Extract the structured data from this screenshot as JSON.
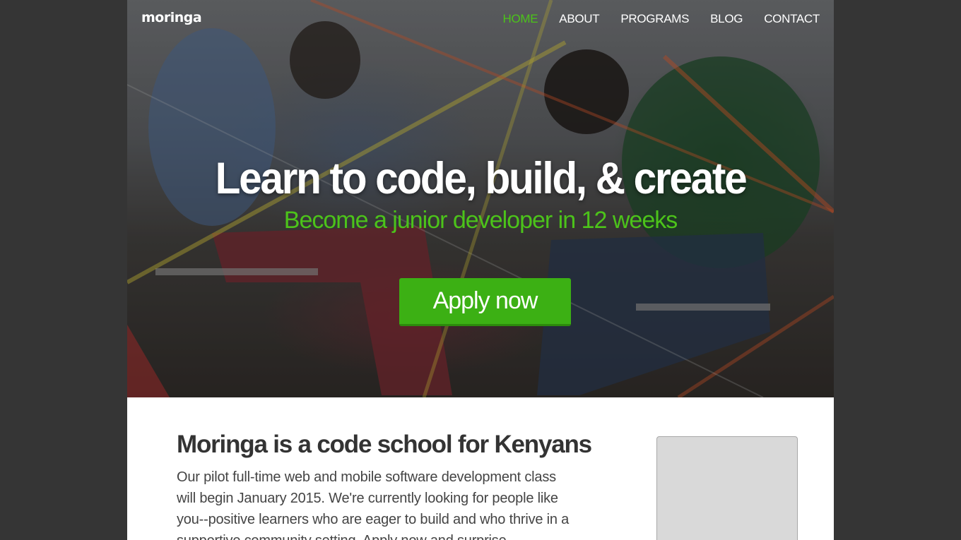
{
  "header": {
    "logo": "moringa",
    "nav": [
      {
        "label": "HOME",
        "active": true
      },
      {
        "label": "ABOUT",
        "active": false
      },
      {
        "label": "PROGRAMS",
        "active": false
      },
      {
        "label": "BLOG",
        "active": false
      },
      {
        "label": "CONTACT",
        "active": false
      }
    ]
  },
  "hero": {
    "headline": "Learn to code, build, & create",
    "subheadline": "Become a junior developer in 12 weeks",
    "cta_label": "Apply now"
  },
  "about": {
    "title": "Moringa is a code school for Kenyans",
    "text": "Our pilot full-time web and mobile software development class will begin January 2015. We're currently looking for people like you--positive learners who are eager to build and who thrive in a supportive community setting. Apply now and surprise"
  },
  "colors": {
    "accent_green": "#4cc31a",
    "button_green": "#3cb014",
    "backdrop": "#353535"
  }
}
